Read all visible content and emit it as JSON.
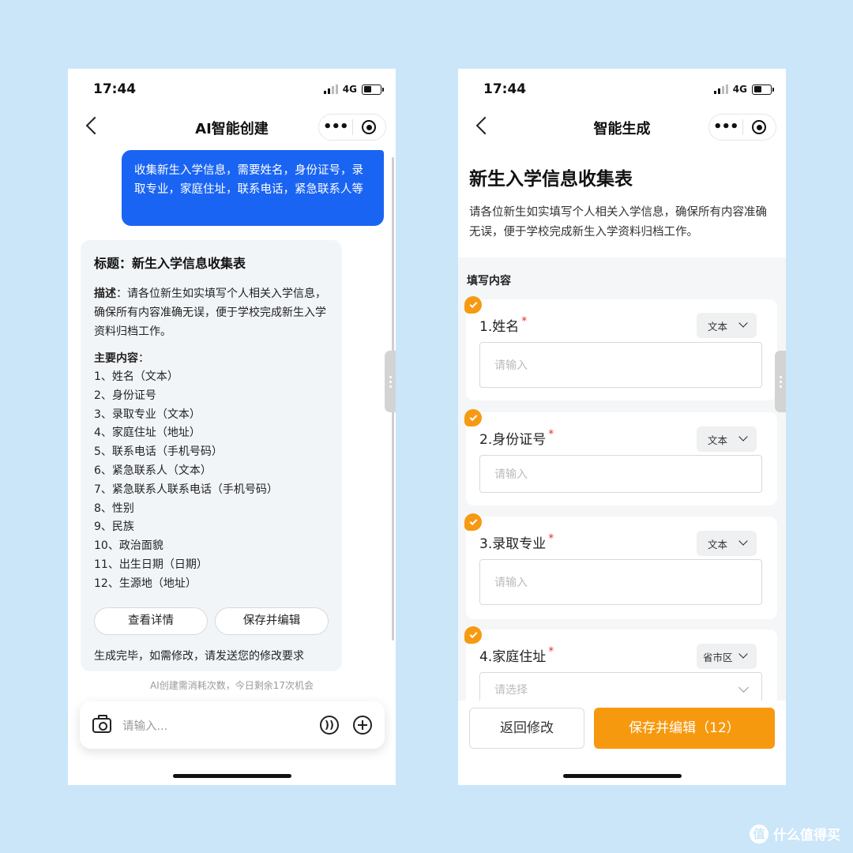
{
  "status": {
    "time": "17:44",
    "network": "4G"
  },
  "left": {
    "nav_title": "AI智能创建",
    "user_message": "收集新生入学信息，需要姓名，身份证号，录取专业，家庭住址，联系电话，紧急联系人等",
    "ai_card": {
      "title": "标题：新生入学信息收集表",
      "desc_label": "描述",
      "desc_text": "：请各位新生如实填写个人相关入学信息，确保所有内容准确无误，便于学校完成新生入学资料归档工作。",
      "list_label": "主要内容",
      "list_colon": "：",
      "items": [
        "1、姓名（文本）",
        "2、身份证号",
        "3、录取专业（文本）",
        "4、家庭住址（地址）",
        "5、联系电话（手机号码）",
        "6、紧急联系人（文本）",
        "7、紧急联系人联系电话（手机号码）",
        "8、性别",
        "9、民族",
        "10、政治面貌",
        "11、出生日期（日期）",
        "12、生源地（地址）"
      ],
      "view_details": "查看详情",
      "save_edit": "保存并编辑",
      "done_text": "生成完毕，如需修改，请发送您的修改要求"
    },
    "quota_note": "AI创建需消耗次数，今日剩余17次机会",
    "input_placeholder": "请输入..."
  },
  "right": {
    "nav_title": "智能生成",
    "form_title": "新生入学信息收集表",
    "form_desc": "请各位新生如实填写个人相关入学信息，确保所有内容准确无误，便于学校完成新生入学资料归档工作。",
    "section_label": "填写内容",
    "fields": [
      {
        "label": "1.姓名",
        "type": "文本",
        "placeholder": "请输入"
      },
      {
        "label": "2.身份证号",
        "type": "文本",
        "placeholder": "请输入"
      },
      {
        "label": "3.录取专业",
        "type": "文本",
        "placeholder": "请输入"
      },
      {
        "label": "4.家庭住址",
        "type": "省市区",
        "placeholder": "请选择"
      }
    ],
    "required_mark": "*",
    "back_button": "返回修改",
    "save_button": "保存并编辑（12）"
  },
  "watermark": {
    "logo_char": "值",
    "text": "什么值得买"
  },
  "colors": {
    "background": "#cbe6f9",
    "user_bubble": "#1a64f3",
    "accent_orange": "#f7990f",
    "required_red": "#e0302a"
  }
}
